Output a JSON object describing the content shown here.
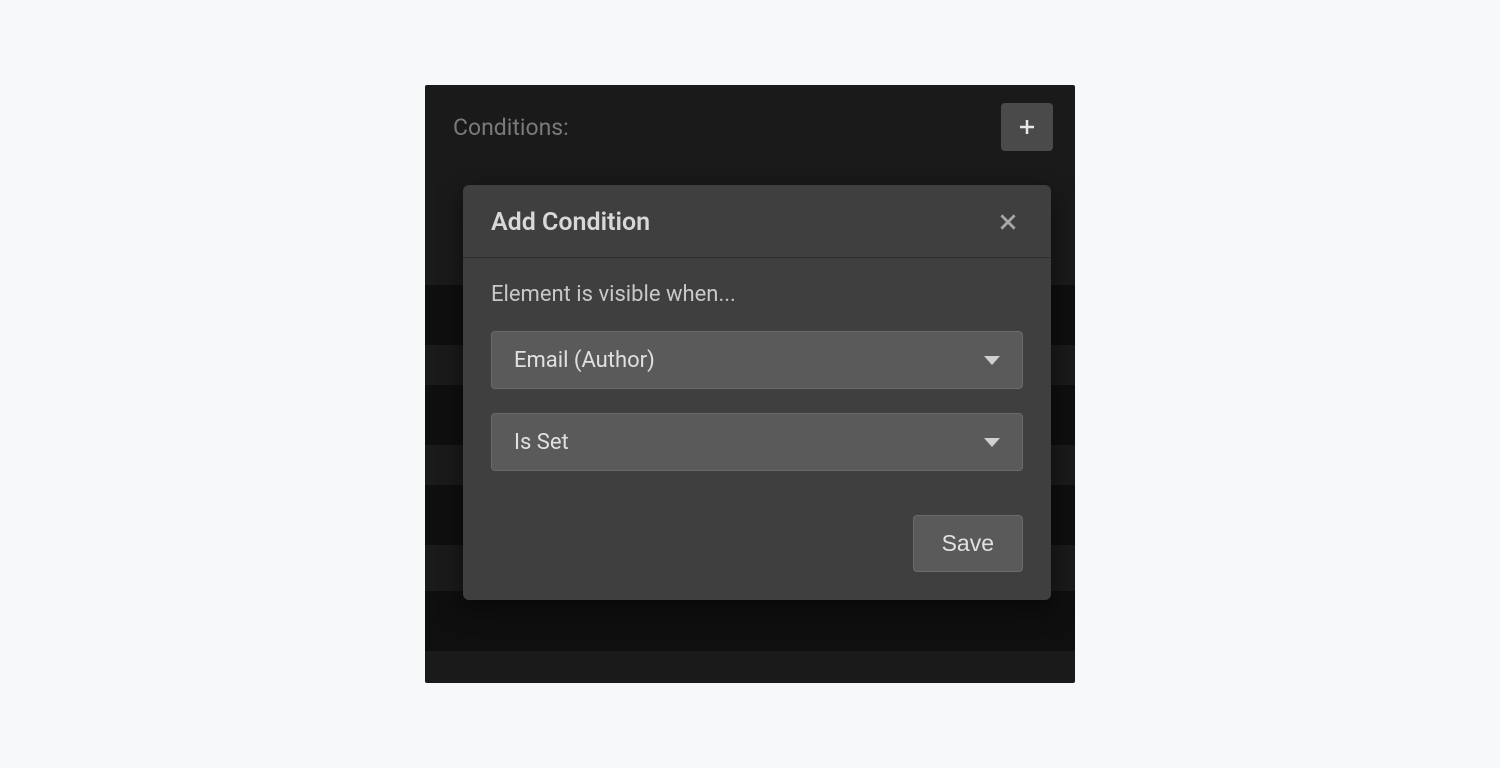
{
  "panel": {
    "label": "Conditions:"
  },
  "dialog": {
    "title": "Add Condition",
    "description": "Element is visible when...",
    "field_select": "Email (Author)",
    "operator_select": "Is Set",
    "save_label": "Save"
  }
}
